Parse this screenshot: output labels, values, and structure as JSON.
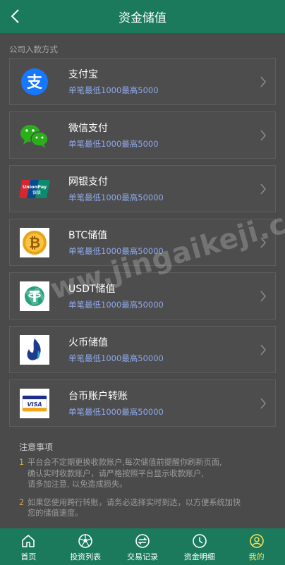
{
  "header": {
    "title": "资金储值"
  },
  "section_label": "公司入款方式",
  "methods": [
    {
      "name": "支付宝",
      "limit": "单笔最低1000最高5000",
      "icon": "alipay-icon"
    },
    {
      "name": "微信支付",
      "limit": "单笔最低1000最高5000",
      "icon": "wechat-icon"
    },
    {
      "name": "网银支付",
      "limit": "单笔最低1000最高50000",
      "icon": "unionpay-icon"
    },
    {
      "name": "BTC储值",
      "limit": "单笔最低1000最高50000",
      "icon": "bitcoin-icon"
    },
    {
      "name": "USDT储值",
      "limit": "单笔最低1000最高50000",
      "icon": "tether-icon"
    },
    {
      "name": "火币储值",
      "limit": "单笔最低1000最高50000",
      "icon": "huobi-icon"
    },
    {
      "name": "台币账户转账",
      "limit": "单笔最低1000最高50000",
      "icon": "visa-icon"
    }
  ],
  "notes": {
    "title": "注意事项",
    "items": [
      {
        "num": "1",
        "text": "平台会不定期更换收款账户,每次储值前提醒你刷新页面,\n确认实时收款账户，请严格按照平台显示收款账户,\n请多加注意, 以免造成损失。"
      },
      {
        "num": "2",
        "text": "如果您使用跨行转账，请务必选择实时到达，以方便系统加快\n您的储值速度。"
      }
    ]
  },
  "watermark": "www.jingaikeji.com",
  "tabbar": [
    {
      "label": "首页",
      "icon": "home-icon"
    },
    {
      "label": "投资列表",
      "icon": "soccer-ball-icon"
    },
    {
      "label": "交易记录",
      "icon": "exchange-icon"
    },
    {
      "label": "资金明细",
      "icon": "clock-icon"
    },
    {
      "label": "我的",
      "icon": "user-icon",
      "active": true
    }
  ],
  "colors": {
    "primary": "#1b7a5c",
    "background": "#4a4a4a",
    "limit_text": "#8fa8ea",
    "active_tab": "#f5e05a",
    "note_number": "#d9a64a"
  }
}
